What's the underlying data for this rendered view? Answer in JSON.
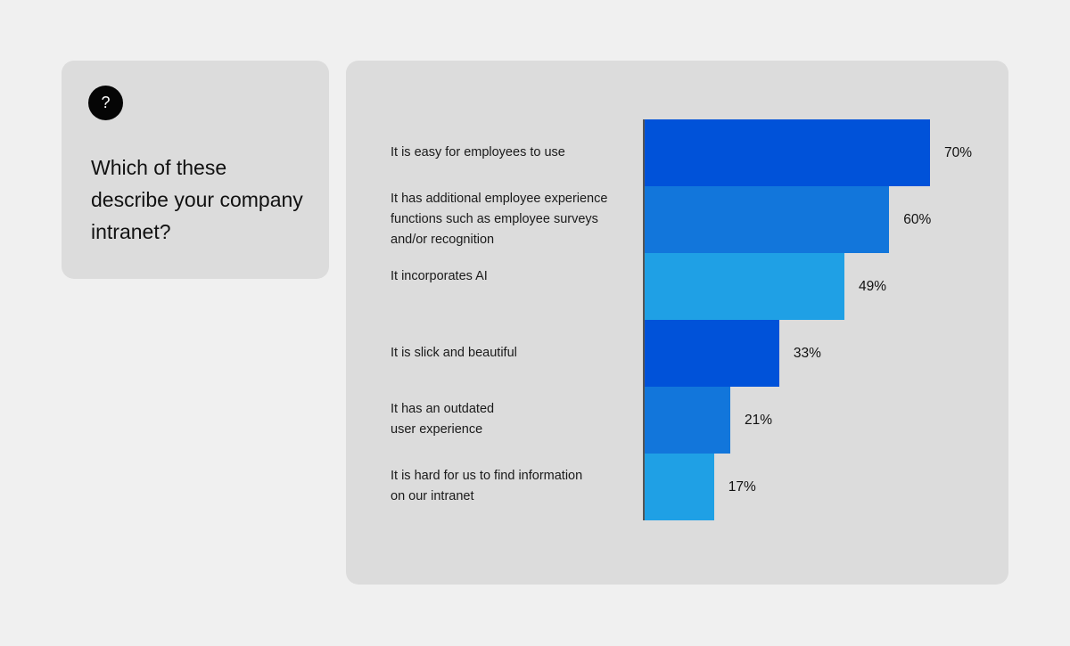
{
  "question": {
    "icon": "question-mark-icon",
    "icon_glyph": "?",
    "text": "Which of these describe your company intranet?"
  },
  "chart_data": {
    "type": "bar",
    "orientation": "horizontal",
    "title": "",
    "xlabel": "",
    "ylabel": "",
    "xlim": [
      0,
      70
    ],
    "grid": false,
    "value_format": "percent",
    "categories": [
      "It is easy for employees to use",
      "It has additional employee experience functions such as employee surveys and/or recognition",
      "It incorporates AI",
      "It is slick and beautiful",
      "It has an outdated user experience",
      "It is hard for us to find information on our intranet"
    ],
    "category_lines": [
      [
        "It is easy for employees to use"
      ],
      [
        "It has additional employee experience",
        "functions such as employee surveys",
        "and/or recognition"
      ],
      [
        "It incorporates AI"
      ],
      [
        "It is slick and beautiful"
      ],
      [
        "It has an outdated",
        "user experience"
      ],
      [
        "It is hard for us to find information",
        "on our intranet"
      ]
    ],
    "values": [
      70,
      60,
      49,
      33,
      21,
      17
    ],
    "data_labels": [
      "70%",
      "60%",
      "49%",
      "33%",
      "21%",
      "17%"
    ],
    "colors": [
      "#0052d9",
      "#1276db",
      "#1fa0e5",
      "#0052d9",
      "#1276db",
      "#1fa0e5"
    ]
  }
}
